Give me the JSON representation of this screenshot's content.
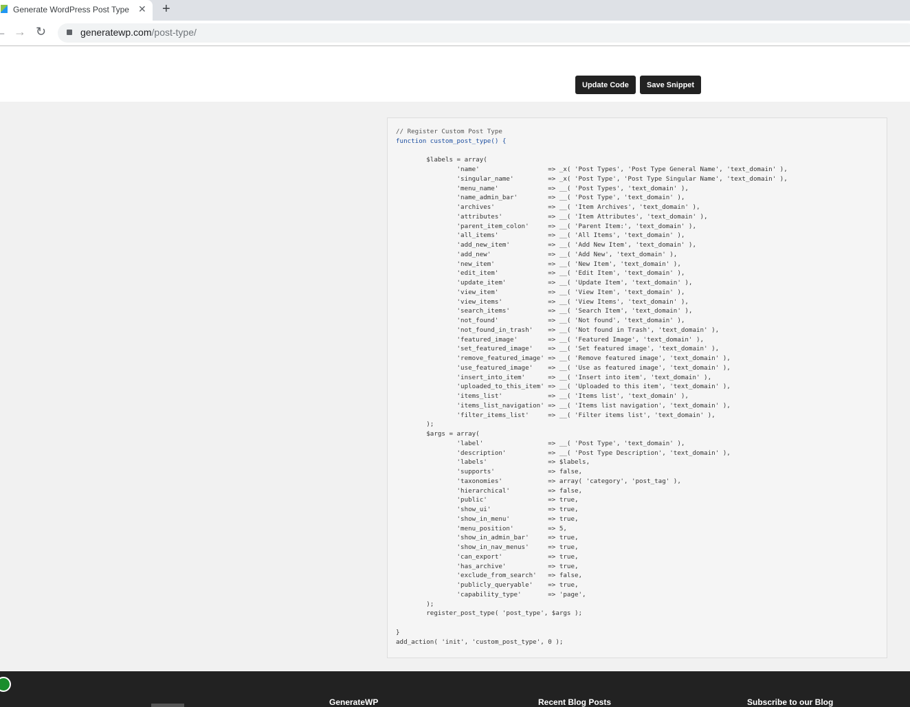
{
  "browser": {
    "tab_title": "Generate WordPress Post Type",
    "url_domain": "generatewp.com",
    "url_path": "/post-type/"
  },
  "actions": {
    "update": "Update Code",
    "save": "Save Snippet"
  },
  "code": {
    "lines": [
      "// Register Custom Post Type",
      "function custom_post_type() {",
      "",
      "\t$labels = array(",
      "\t\t'name'                  => _x( 'Post Types', 'Post Type General Name', 'text_domain' ),",
      "\t\t'singular_name'         => _x( 'Post Type', 'Post Type Singular Name', 'text_domain' ),",
      "\t\t'menu_name'             => __( 'Post Types', 'text_domain' ),",
      "\t\t'name_admin_bar'        => __( 'Post Type', 'text_domain' ),",
      "\t\t'archives'              => __( 'Item Archives', 'text_domain' ),",
      "\t\t'attributes'            => __( 'Item Attributes', 'text_domain' ),",
      "\t\t'parent_item_colon'     => __( 'Parent Item:', 'text_domain' ),",
      "\t\t'all_items'             => __( 'All Items', 'text_domain' ),",
      "\t\t'add_new_item'          => __( 'Add New Item', 'text_domain' ),",
      "\t\t'add_new'               => __( 'Add New', 'text_domain' ),",
      "\t\t'new_item'              => __( 'New Item', 'text_domain' ),",
      "\t\t'edit_item'             => __( 'Edit Item', 'text_domain' ),",
      "\t\t'update_item'           => __( 'Update Item', 'text_domain' ),",
      "\t\t'view_item'             => __( 'View Item', 'text_domain' ),",
      "\t\t'view_items'            => __( 'View Items', 'text_domain' ),",
      "\t\t'search_items'          => __( 'Search Item', 'text_domain' ),",
      "\t\t'not_found'             => __( 'Not found', 'text_domain' ),",
      "\t\t'not_found_in_trash'    => __( 'Not found in Trash', 'text_domain' ),",
      "\t\t'featured_image'        => __( 'Featured Image', 'text_domain' ),",
      "\t\t'set_featured_image'    => __( 'Set featured image', 'text_domain' ),",
      "\t\t'remove_featured_image' => __( 'Remove featured image', 'text_domain' ),",
      "\t\t'use_featured_image'    => __( 'Use as featured image', 'text_domain' ),",
      "\t\t'insert_into_item'      => __( 'Insert into item', 'text_domain' ),",
      "\t\t'uploaded_to_this_item' => __( 'Uploaded to this item', 'text_domain' ),",
      "\t\t'items_list'            => __( 'Items list', 'text_domain' ),",
      "\t\t'items_list_navigation' => __( 'Items list navigation', 'text_domain' ),",
      "\t\t'filter_items_list'     => __( 'Filter items list', 'text_domain' ),",
      "\t);",
      "\t$args = array(",
      "\t\t'label'                 => __( 'Post Type', 'text_domain' ),",
      "\t\t'description'           => __( 'Post Type Description', 'text_domain' ),",
      "\t\t'labels'                => $labels,",
      "\t\t'supports'              => false,",
      "\t\t'taxonomies'            => array( 'category', 'post_tag' ),",
      "\t\t'hierarchical'          => false,",
      "\t\t'public'                => true,",
      "\t\t'show_ui'               => true,",
      "\t\t'show_in_menu'          => true,",
      "\t\t'menu_position'         => 5,",
      "\t\t'show_in_admin_bar'     => true,",
      "\t\t'show_in_nav_menus'     => true,",
      "\t\t'can_export'            => true,",
      "\t\t'has_archive'           => true,",
      "\t\t'exclude_from_search'   => false,",
      "\t\t'publicly_queryable'    => true,",
      "\t\t'capability_type'       => 'page',",
      "\t);",
      "\tregister_post_type( 'post_type', $args );",
      "",
      "}",
      "add_action( 'init', 'custom_post_type', 0 );"
    ]
  },
  "footer": {
    "col1": "GenerateWP",
    "col2": "Recent Blog Posts",
    "col3": "Subscribe to our Blog"
  }
}
